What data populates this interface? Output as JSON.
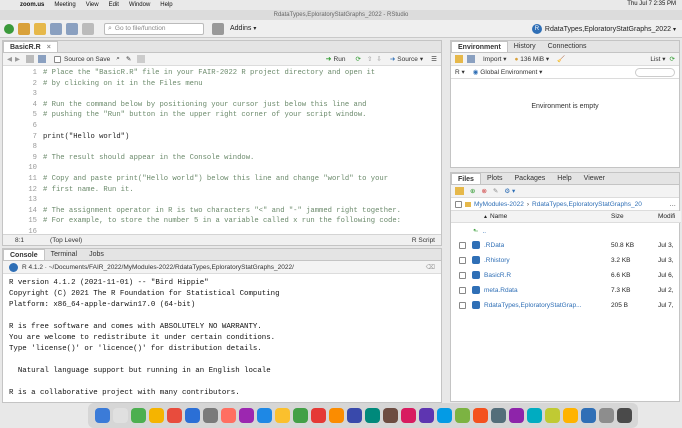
{
  "menubar": {
    "app": "zoom.us",
    "items": [
      "Meeting",
      "View",
      "Edit",
      "Window",
      "Help"
    ],
    "clock": "Thu Jul 7  2:35 PM"
  },
  "window_title": "RdataTypes,EploratoryStatGraphs_2022 - RStudio",
  "toolbar": {
    "goto_placeholder": "Go to file/function",
    "addins_label": "Addins",
    "project_label": "RdataTypes,EploratoryStatGraphs_2022"
  },
  "source_pane": {
    "tab": "BasicR.R",
    "source_on_save": "Source on Save",
    "run_label": "Run",
    "source_label": "Source",
    "line_numbers": [
      "1",
      "2",
      "3",
      "4",
      "5",
      "6",
      "7",
      "8",
      "9",
      "10",
      "11",
      "12",
      "13",
      "14",
      "15",
      "16"
    ],
    "lines": [
      "# Place the \"BasicR.R\" file in your FAIR-2022 R project directory and open it",
      "# by clicking on it in the Files menu",
      "",
      "# Run the command below by positioning your cursor just below this line and",
      "# pushing the \"Run\" button in the upper right corner of your script window.",
      "",
      "print(\"Hello world\")",
      "",
      "# The result should appear in the Console window.",
      "",
      "# Copy and paste print(\"Hello world\") below this line and change \"world\" to your",
      "# first name. Run it.",
      "",
      "# The assignment operator in R is two characters \"<\" and \"-\" jammed right together.",
      "# For example, to store the number 5 in a variable called x run the following code:",
      ""
    ],
    "status_pos": "8:1",
    "status_scope": "(Top Level)",
    "status_type": "R Script"
  },
  "console_pane": {
    "tabs": [
      "Console",
      "Terminal",
      "Jobs"
    ],
    "path": "R 4.1.2 · ~/Documents/FAIR_2022/MyModules-2022/RdataTypes,EploratoryStatGraphs_2022/",
    "lines": [
      "R version 4.1.2 (2021-11-01) -- \"Bird Hippie\"",
      "Copyright (C) 2021 The R Foundation for Statistical Computing",
      "Platform: x86_64-apple-darwin17.0 (64-bit)",
      "",
      "R is free software and comes with ABSOLUTELY NO WARRANTY.",
      "You are welcome to redistribute it under certain conditions.",
      "Type 'license()' or 'licence()' for distribution details.",
      "",
      "  Natural language support but running in an English locale",
      "",
      "R is a collaborative project with many contributors."
    ]
  },
  "env_pane": {
    "tabs": [
      "Environment",
      "History",
      "Connections"
    ],
    "import_label": "Import",
    "memory": "136 MiB",
    "list_label": "List",
    "lang": "R",
    "env_label": "Global Environment",
    "empty_msg": "Environment is empty"
  },
  "files_pane": {
    "tabs": [
      "Files",
      "Plots",
      "Packages",
      "Help",
      "Viewer"
    ],
    "breadcrumb": [
      "MyModules-2022",
      "RdataTypes,EploratoryStatGraphs_2022"
    ],
    "columns": [
      "Name",
      "Size",
      "Modifi"
    ],
    "parent": "..",
    "rows": [
      {
        "name": ".RData",
        "size": "50.8 KB",
        "mod": "Jul 3,"
      },
      {
        "name": ".Rhistory",
        "size": "3.2 KB",
        "mod": "Jul 3,"
      },
      {
        "name": "BasicR.R",
        "size": "6.6 KB",
        "mod": "Jul 6,"
      },
      {
        "name": "meta.Rdata",
        "size": "7.3 KB",
        "mod": "Jul 2,"
      },
      {
        "name": "RdataTypes,EploratoryStatGrap...",
        "size": "205 B",
        "mod": "Jul 7,"
      }
    ]
  },
  "colors": {
    "accent": "#2f6fb6",
    "toolbar": "#efefef",
    "comment": "#6b8a6b",
    "string": "#0a7a2a"
  }
}
